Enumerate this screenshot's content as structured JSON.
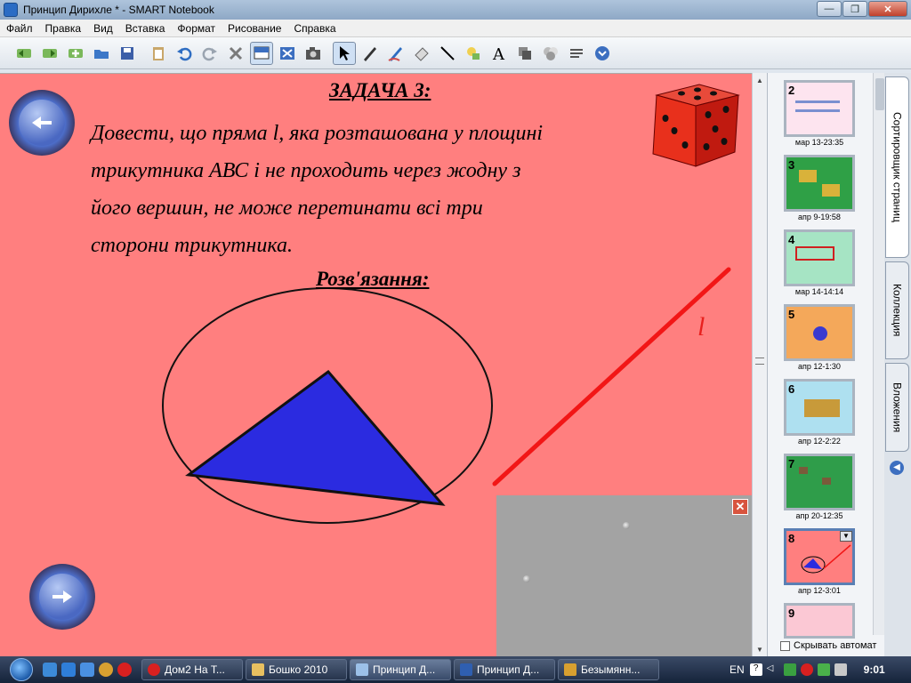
{
  "window": {
    "title": "Принцип Дирихле * - SMART Notebook"
  },
  "menu": [
    "Файл",
    "Правка",
    "Вид",
    "Вставка",
    "Формат",
    "Рисование",
    "Справка"
  ],
  "toolbar": {
    "buttons": [
      "back-icon",
      "forward-icon",
      "add-page-icon",
      "open-icon",
      "save-icon",
      "paste-icon",
      "undo-icon",
      "redo-icon",
      "delete-icon",
      "screen-shade-icon",
      "full-screen-icon",
      "camera-icon",
      "select-icon",
      "pen-icon",
      "creative-pen-icon",
      "eraser-icon",
      "line-icon",
      "shape-icon",
      "text-icon",
      "fill-icon",
      "properties-icon",
      "more-icon",
      "down-icon"
    ]
  },
  "canvas": {
    "task_title": "ЗАДАЧА 3:",
    "task_lines": [
      "Довести, що пряма l, яка розташована у площині",
      "трикутника АВС і  не проходить  через жодну з",
      "його вершин,  не може перетинати всі три",
      "сторони трикутника."
    ],
    "solution_title": "Розв'язання:",
    "line_label": "l",
    "colors": {
      "background": "#ff7f7f",
      "triangle": "#2b2be0",
      "line": "#f21616"
    }
  },
  "pages": [
    {
      "num": "2",
      "caption": "мар 13-23:35"
    },
    {
      "num": "3",
      "caption": "апр 9-19:58"
    },
    {
      "num": "4",
      "caption": "мар 14-14:14"
    },
    {
      "num": "5",
      "caption": "апр 12-1:30"
    },
    {
      "num": "6",
      "caption": "апр 12-2:22"
    },
    {
      "num": "7",
      "caption": "апр 20-12:35"
    },
    {
      "num": "8",
      "caption": "апр 12-3:01"
    },
    {
      "num": "9",
      "caption": ""
    }
  ],
  "sidebar": {
    "auto_hide": "Скрывать автомат"
  },
  "tabs": [
    "Сортировщик страниц",
    "Коллекция",
    "Вложения"
  ],
  "taskbar": {
    "tasks": [
      "Дом2 На Т...",
      "Бошко 2010",
      "Принцип Д...",
      "Принцип Д...",
      "Безымянн..."
    ],
    "lang": "EN",
    "clock": "9:01"
  }
}
